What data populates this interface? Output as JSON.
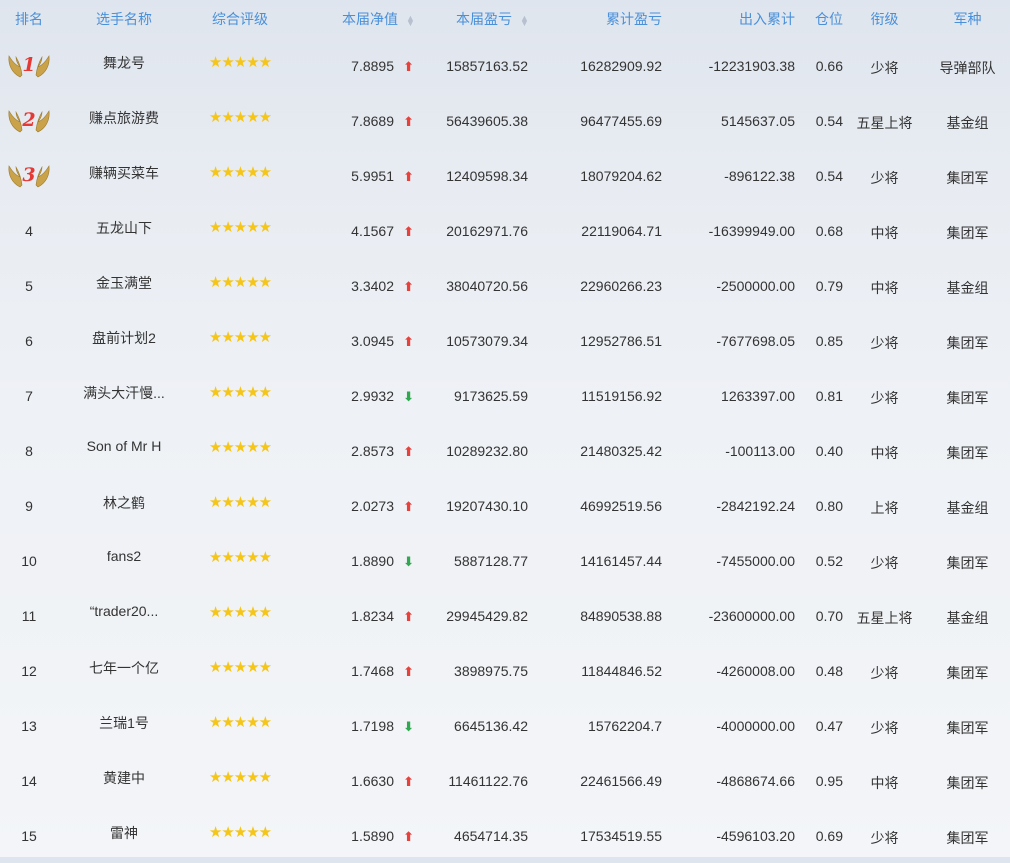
{
  "headers": {
    "rank": "排名",
    "name": "选手名称",
    "rating": "综合评级",
    "nav": "本届净值",
    "current_pnl": "本届盈亏",
    "cumulative_pnl": "累计盈亏",
    "net_flow": "出入累计",
    "position": "仓位",
    "grade": "衔级",
    "arm": "军种"
  },
  "rating_stars": "★★★★★",
  "colors": {
    "header": "#4a90d9",
    "up": "#e8403a",
    "down": "#2fa84f",
    "star": "#f5c518",
    "medal": "#e53935"
  },
  "rows": [
    {
      "rank": "1",
      "name": "舞龙号",
      "nav": "7.8895",
      "trend": "up",
      "current_pnl": "15857163.52",
      "cumulative_pnl": "16282909.92",
      "net_flow": "-12231903.38",
      "position": "0.66",
      "grade": "少将",
      "arm": "导弹部队",
      "medal": true
    },
    {
      "rank": "2",
      "name": "赚点旅游费",
      "nav": "7.8689",
      "trend": "up",
      "current_pnl": "56439605.38",
      "cumulative_pnl": "96477455.69",
      "net_flow": "5145637.05",
      "position": "0.54",
      "grade": "五星上将",
      "arm": "基金组",
      "medal": true
    },
    {
      "rank": "3",
      "name": "赚辆买菜车",
      "nav": "5.9951",
      "trend": "up",
      "current_pnl": "12409598.34",
      "cumulative_pnl": "18079204.62",
      "net_flow": "-896122.38",
      "position": "0.54",
      "grade": "少将",
      "arm": "集团军",
      "medal": true
    },
    {
      "rank": "4",
      "name": "五龙山下",
      "nav": "4.1567",
      "trend": "up",
      "current_pnl": "20162971.76",
      "cumulative_pnl": "22119064.71",
      "net_flow": "-16399949.00",
      "position": "0.68",
      "grade": "中将",
      "arm": "集团军"
    },
    {
      "rank": "5",
      "name": "金玉满堂",
      "nav": "3.3402",
      "trend": "up",
      "current_pnl": "38040720.56",
      "cumulative_pnl": "22960266.23",
      "net_flow": "-2500000.00",
      "position": "0.79",
      "grade": "中将",
      "arm": "基金组"
    },
    {
      "rank": "6",
      "name": "盘前计划2",
      "nav": "3.0945",
      "trend": "up",
      "current_pnl": "10573079.34",
      "cumulative_pnl": "12952786.51",
      "net_flow": "-7677698.05",
      "position": "0.85",
      "grade": "少将",
      "arm": "集团军"
    },
    {
      "rank": "7",
      "name": "满头大汗慢...",
      "nav": "2.9932",
      "trend": "down",
      "current_pnl": "9173625.59",
      "cumulative_pnl": "11519156.92",
      "net_flow": "1263397.00",
      "position": "0.81",
      "grade": "少将",
      "arm": "集团军"
    },
    {
      "rank": "8",
      "name": "Son of Mr H",
      "nav": "2.8573",
      "trend": "up",
      "current_pnl": "10289232.80",
      "cumulative_pnl": "21480325.42",
      "net_flow": "-100113.00",
      "position": "0.40",
      "grade": "中将",
      "arm": "集团军"
    },
    {
      "rank": "9",
      "name": "林之鹤",
      "nav": "2.0273",
      "trend": "up",
      "current_pnl": "19207430.10",
      "cumulative_pnl": "46992519.56",
      "net_flow": "-2842192.24",
      "position": "0.80",
      "grade": "上将",
      "arm": "基金组"
    },
    {
      "rank": "10",
      "name": "fans2",
      "nav": "1.8890",
      "trend": "down",
      "current_pnl": "5887128.77",
      "cumulative_pnl": "14161457.44",
      "net_flow": "-7455000.00",
      "position": "0.52",
      "grade": "少将",
      "arm": "集团军"
    },
    {
      "rank": "11",
      "name": "“trader20...",
      "nav": "1.8234",
      "trend": "up",
      "current_pnl": "29945429.82",
      "cumulative_pnl": "84890538.88",
      "net_flow": "-23600000.00",
      "position": "0.70",
      "grade": "五星上将",
      "arm": "基金组"
    },
    {
      "rank": "12",
      "name": "七年一个亿",
      "nav": "1.7468",
      "trend": "up",
      "current_pnl": "3898975.75",
      "cumulative_pnl": "11844846.52",
      "net_flow": "-4260008.00",
      "position": "0.48",
      "grade": "少将",
      "arm": "集团军"
    },
    {
      "rank": "13",
      "name": "兰瑞1号",
      "nav": "1.7198",
      "trend": "down",
      "current_pnl": "6645136.42",
      "cumulative_pnl": "15762204.7",
      "net_flow": "-4000000.00",
      "position": "0.47",
      "grade": "少将",
      "arm": "集团军"
    },
    {
      "rank": "14",
      "name": "黄建中",
      "nav": "1.6630",
      "trend": "up",
      "current_pnl": "11461122.76",
      "cumulative_pnl": "22461566.49",
      "net_flow": "-4868674.66",
      "position": "0.95",
      "grade": "中将",
      "arm": "集团军"
    },
    {
      "rank": "15",
      "name": "雷神",
      "nav": "1.5890",
      "trend": "up",
      "current_pnl": "4654714.35",
      "cumulative_pnl": "17534519.55",
      "net_flow": "-4596103.20",
      "position": "0.69",
      "grade": "少将",
      "arm": "集团军"
    }
  ]
}
